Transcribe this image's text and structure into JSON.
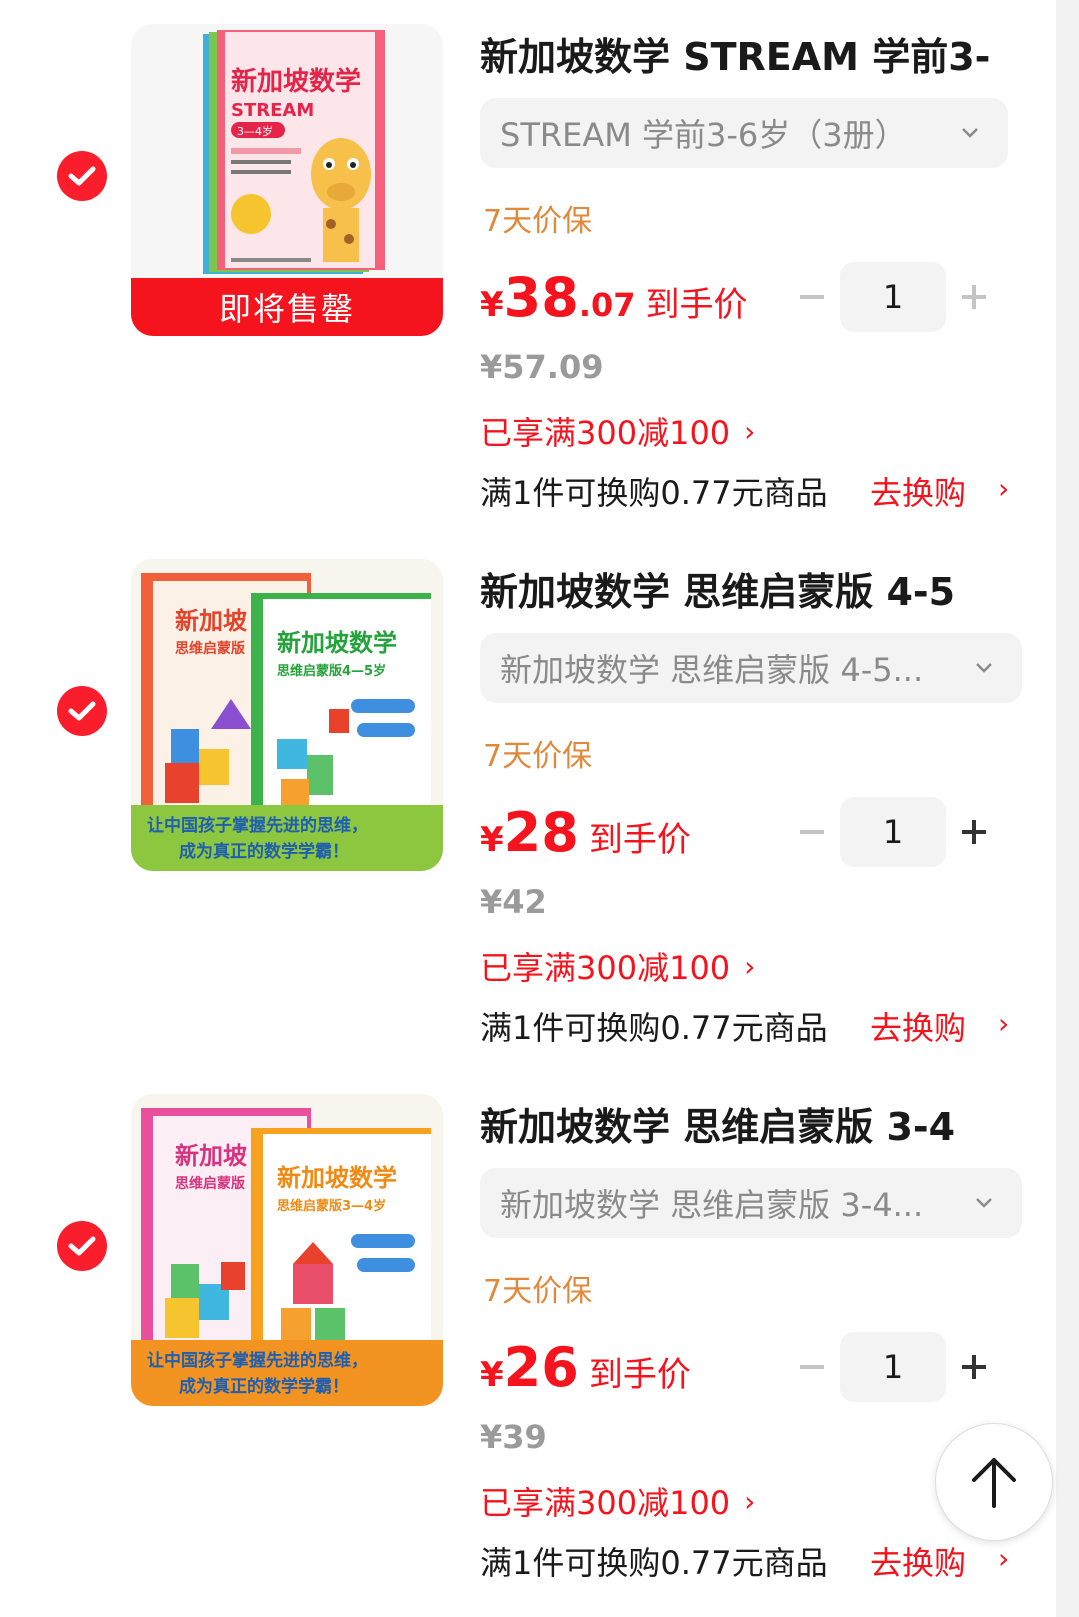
{
  "items": [
    {
      "title": "新加坡数学 STREAM 学前3-",
      "variant": "STREAM 学前3-6岁（3册）",
      "price_protect": "7天价保",
      "price_currency": "¥",
      "price_int": "38",
      "price_dec": ".07",
      "price_label": "到手价",
      "quantity": "1",
      "original_price": "¥57.09",
      "promo": "已享满300减100",
      "swap_text": "满1件可换购0.77元商品",
      "swap_action": "去换购",
      "soldout": "即将售罄",
      "cover": {
        "title_line1": "新加坡数学",
        "title_line2": "STREAM",
        "age": "3—4岁"
      }
    },
    {
      "title": "新加坡数学 思维启蒙版 4-5",
      "variant": "新加坡数学 思维启蒙版 4-5...",
      "price_protect": "7天价保",
      "price_currency": "¥",
      "price_int": "28",
      "price_dec": "",
      "price_label": "到手价",
      "quantity": "1",
      "original_price": "¥42",
      "promo": "已享满300减100",
      "swap_text": "满1件可换购0.77元商品",
      "swap_action": "去换购",
      "cover": {
        "title_line1": "新加坡数学",
        "title_line2": "思维启蒙版4—5岁",
        "banner_line1": "让中国孩子掌握先进的思维，",
        "banner_line2": "成为真正的数学学霸！"
      }
    },
    {
      "title": "新加坡数学 思维启蒙版 3-4",
      "variant": "新加坡数学 思维启蒙版 3-4...",
      "price_protect": "7天价保",
      "price_currency": "¥",
      "price_int": "26",
      "price_dec": "",
      "price_label": "到手价",
      "quantity": "1",
      "original_price": "¥39",
      "promo": "已享满300减100",
      "swap_text": "满1件可换购0.77元商品",
      "swap_action": "去换购",
      "cover": {
        "title_line1": "新加坡数学",
        "title_line2": "思维启蒙版3—4岁",
        "banner_line1": "让中国孩子掌握先进的思维，",
        "banner_line2": "成为真正的数学学霸！"
      }
    }
  ],
  "colors": {
    "accent_red": "#f5141e",
    "protect_orange": "#e1893a",
    "muted_gray": "#9a9a9a"
  },
  "icons": [
    "check-circle-icon",
    "chevron-down-icon",
    "minus-icon",
    "plus-icon",
    "arrow-up-icon"
  ]
}
